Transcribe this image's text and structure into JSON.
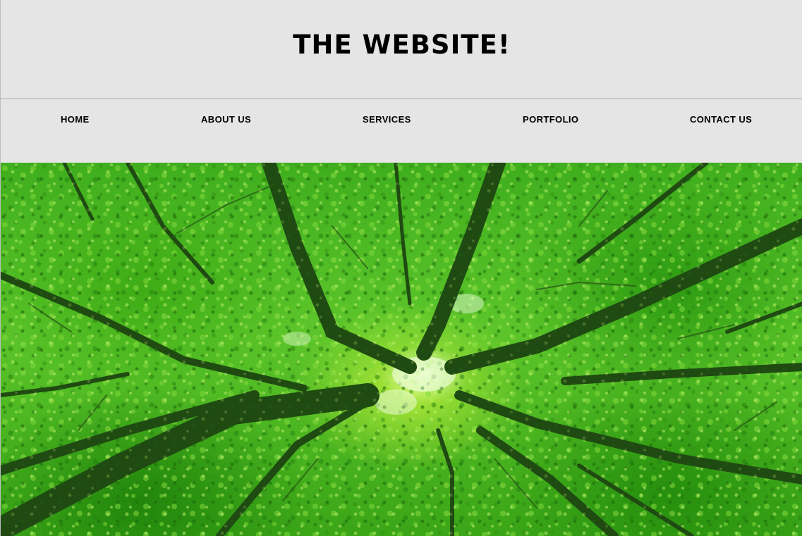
{
  "header": {
    "title": "THE WEBSITE!"
  },
  "nav": {
    "items": [
      {
        "label": "HOME"
      },
      {
        "label": "ABOUT US"
      },
      {
        "label": "SERVICES"
      },
      {
        "label": "PORTFOLIO"
      },
      {
        "label": "CONTACT US"
      }
    ]
  },
  "hero": {
    "image_subject": "forest canopy viewed from below",
    "colors": {
      "background": "#e5e5e5",
      "text": "#000000",
      "foliage": "#4cbb1f",
      "branches": "#1f4a12"
    }
  }
}
